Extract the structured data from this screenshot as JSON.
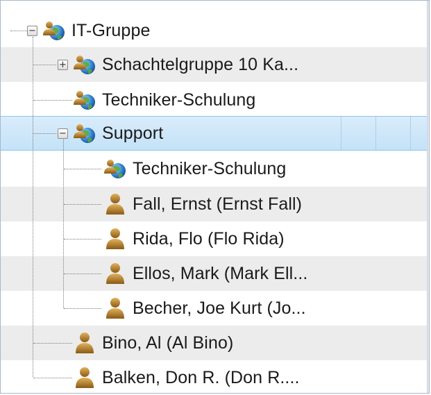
{
  "tree": {
    "nodes": [
      {
        "label": "IT-Gruppe",
        "type": "group",
        "expanded": true,
        "icon": "group-globe-icon"
      },
      {
        "label": "Schachtelgruppe 10 Ka...",
        "type": "group",
        "expanded": false,
        "icon": "group-globe-icon"
      },
      {
        "label": "Techniker-Schulung",
        "type": "group",
        "icon": "group-globe-icon"
      },
      {
        "label": "Support",
        "type": "group",
        "expanded": true,
        "selected": true,
        "icon": "group-globe-icon"
      },
      {
        "label": "Techniker-Schulung",
        "type": "group",
        "icon": "group-globe-icon"
      },
      {
        "label": "Fall, Ernst (Ernst Fall)",
        "type": "user",
        "icon": "user-icon"
      },
      {
        "label": "Rida, Flo (Flo Rida)",
        "type": "user",
        "icon": "user-icon"
      },
      {
        "label": "Ellos, Mark (Mark Ell...",
        "type": "user",
        "icon": "user-icon"
      },
      {
        "label": "Becher, Joe Kurt (Jo...",
        "type": "user",
        "icon": "user-icon"
      },
      {
        "label": "Bino, Al (Al Bino)",
        "type": "user",
        "icon": "user-icon"
      },
      {
        "label": "Balken, Don R. (Don R....",
        "type": "user",
        "icon": "user-icon"
      }
    ],
    "expander_collapse_glyph": "−",
    "expander_expand_glyph": "+"
  },
  "colors": {
    "selected_background": "#c4e2f7",
    "alternate_row": "#ececec",
    "user_icon": "#b8842a",
    "connector": "#7a7a7a"
  }
}
